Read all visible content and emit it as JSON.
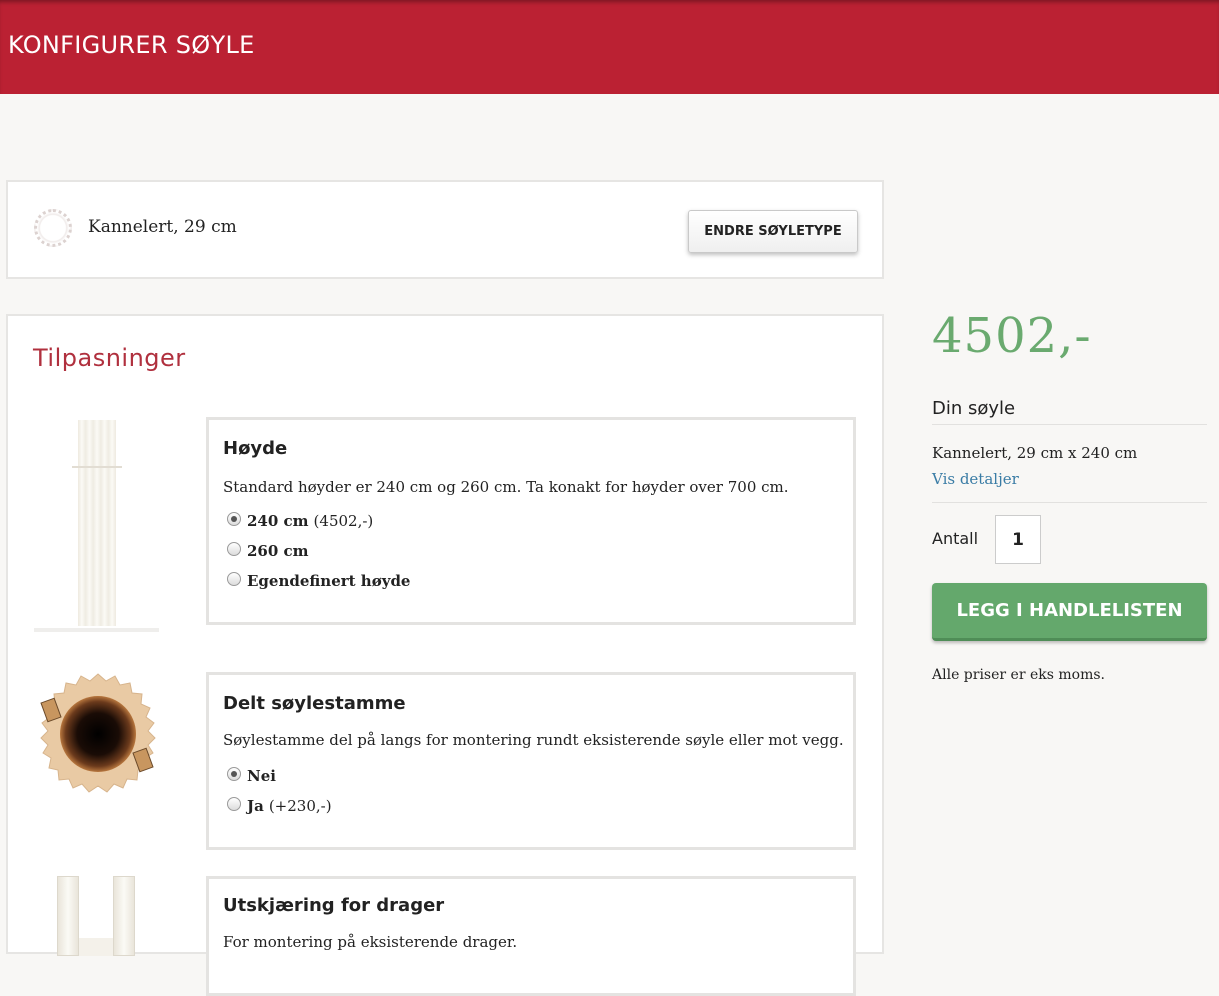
{
  "header": {
    "title": "KONFIGURER SØYLE"
  },
  "column_type": {
    "icon": "fluted-column-ring-icon",
    "label": "Kannelert, 29 cm",
    "change_button": "ENDRE SØYLETYPE"
  },
  "customizations": {
    "title": "Tilpasninger",
    "height": {
      "title": "Høyde",
      "description": "Standard høyder er 240 cm og 260 cm. Ta konakt for høyder over 700 cm.",
      "options": [
        {
          "label": "240 cm",
          "extra": "(4502,-)",
          "selected": true
        },
        {
          "label": "260 cm",
          "extra": "",
          "selected": false
        },
        {
          "label": "Egendefinert høyde",
          "extra": "",
          "selected": false
        }
      ]
    },
    "split": {
      "title": "Delt søylestamme",
      "description": "Søylestamme del på langs for montering rundt eksisterende søyle eller mot vegg.",
      "options": [
        {
          "label": "Nei",
          "extra": "",
          "selected": true
        },
        {
          "label": "Ja",
          "extra": "(+230,-)",
          "selected": false
        }
      ]
    },
    "beam": {
      "title": "Utskjæring for drager",
      "description": "For montering på eksisterende drager."
    }
  },
  "summary": {
    "price": "4502,-",
    "heading": "Din søyle",
    "spec": "Kannelert, 29 cm x 240 cm",
    "details_link": "Vis detaljer",
    "quantity_label": "Antall",
    "quantity": "1",
    "cart_button": "LEGG I HANDLELISTEN",
    "vat_note": "Alle priser er eks moms."
  },
  "colors": {
    "header": "#bb2133",
    "accent_title": "#b0303e",
    "price": "#6aaa6f",
    "cart_button": "#64a86c",
    "link": "#3a7ca5"
  }
}
